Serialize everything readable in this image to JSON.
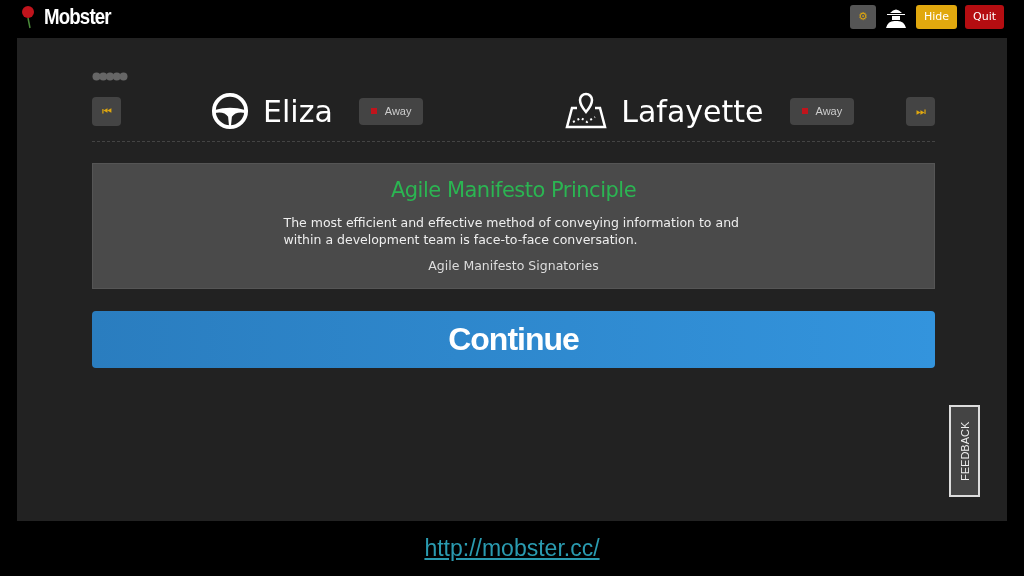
{
  "header": {
    "title": "Mobster",
    "buttons": [
      {
        "kind": "settings",
        "label": "⚙"
      },
      {
        "kind": "hide",
        "label": "Hide"
      },
      {
        "kind": "quit",
        "label": "Quit"
      }
    ]
  },
  "roles": [
    {
      "kind": "driver",
      "name": "Eliza",
      "status": {
        "label": "Away",
        "color": "#c0141c"
      }
    },
    {
      "kind": "navigator",
      "name": "Lafayette",
      "status": {
        "label": "Away",
        "color": "#c0141c"
      }
    }
  ],
  "nav": {
    "previous": "⏮",
    "next": "⏭"
  },
  "principle": {
    "title": "Agile Manifesto Principle",
    "text": "The most efficient and effective method of conveying information to and within a development team is face-to-face conversation.",
    "author": "Agile Manifesto Signatories"
  },
  "continue_button": "Continue",
  "feedback_tab": "FEEDBACK",
  "footer_link": "http://mobster.cc/"
}
